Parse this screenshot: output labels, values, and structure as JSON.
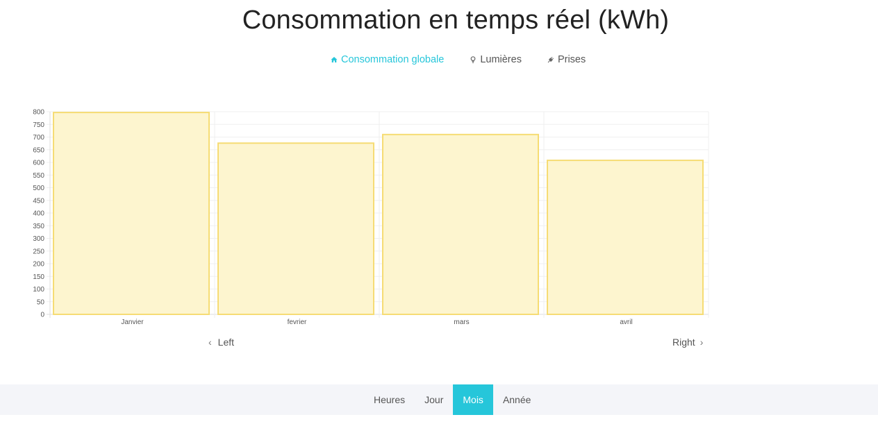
{
  "header": {
    "title": "Consommation en temps réel (kWh)"
  },
  "tabs": [
    {
      "label": "Consommation globale",
      "icon": "home-icon",
      "active": true
    },
    {
      "label": "Lumières",
      "icon": "lightbulb-icon",
      "active": false
    },
    {
      "label": "Prises",
      "icon": "plug-icon",
      "active": false
    }
  ],
  "navigation": {
    "left_label": "Left",
    "right_label": "Right"
  },
  "periods": [
    {
      "label": "Heures",
      "active": false
    },
    {
      "label": "Jour",
      "active": false
    },
    {
      "label": "Mois",
      "active": true
    },
    {
      "label": "Année",
      "active": false
    }
  ],
  "colors": {
    "accent": "#26c6da",
    "bar_fill": "#fdf5cf",
    "bar_stroke": "#f6dc74"
  },
  "chart_data": {
    "type": "bar",
    "categories": [
      "Janvier",
      "fevrier",
      "mars",
      "avril"
    ],
    "values": [
      797,
      676,
      710,
      608
    ],
    "ylim": [
      0,
      800
    ],
    "yticks": [
      0,
      50,
      100,
      150,
      200,
      250,
      300,
      350,
      400,
      450,
      500,
      550,
      600,
      650,
      700,
      750,
      800
    ],
    "grid": true,
    "legend": "none"
  }
}
